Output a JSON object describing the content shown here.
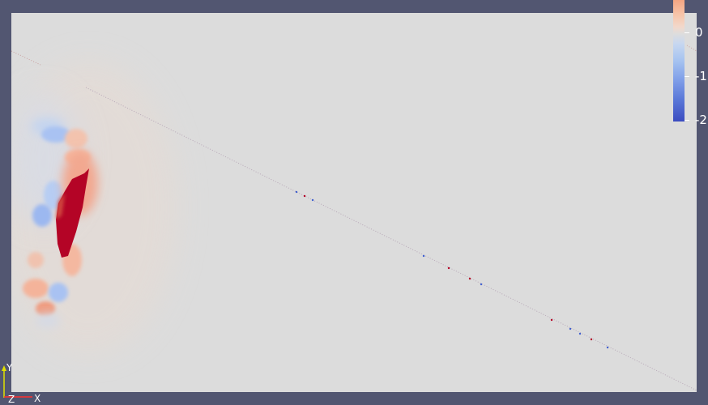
{
  "scene": {
    "background_color": "#525671",
    "viewport_color": "#dcdcdc"
  },
  "colorbar": {
    "colormap": "cool-warm",
    "high_color": "#f4a582",
    "mid_color": "#dddddd",
    "low_color": "#3b4cc0",
    "tick_labels": [
      "0",
      "-1",
      "-2"
    ]
  },
  "axes": {
    "y_label": "Y",
    "z_label": "Z",
    "x_label": "X",
    "y_color": "#e0e000",
    "x_color": "#ff3030"
  },
  "plot": {
    "hot_color": "#b40426",
    "warm_color": "#f0a080",
    "cool_color": "#88aaee"
  }
}
